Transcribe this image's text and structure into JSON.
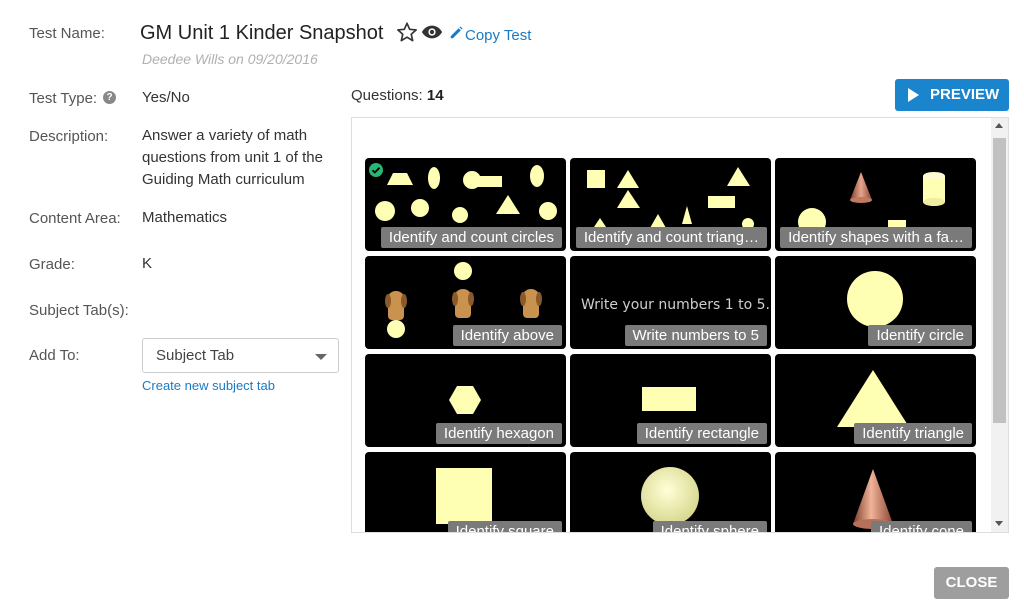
{
  "labels": {
    "test_name": "Test Name:",
    "test_type": "Test Type:",
    "description": "Description:",
    "content_area": "Content Area:",
    "grade": "Grade:",
    "subject_tabs": "Subject Tab(s):",
    "add_to": "Add To:"
  },
  "test": {
    "title": "GM Unit 1 Kinder Snapshot",
    "author_line": "Deedee Wills on 09/20/2016",
    "copy_label": "Copy Test",
    "type": "Yes/No",
    "description_lines": [
      "Answer a variety of math",
      "questions from unit 1 of the",
      "Guiding Math curriculum"
    ],
    "content_area": "Mathematics",
    "grade": "K"
  },
  "add_to": {
    "selected": "Subject Tab",
    "create_link": "Create new subject tab"
  },
  "questions": {
    "label": "Questions:",
    "count": "14"
  },
  "buttons": {
    "preview": "PREVIEW",
    "close": "CLOSE"
  },
  "tiles": [
    {
      "caption": "Identify and count circles"
    },
    {
      "caption": "Identify and count triang…"
    },
    {
      "caption": "Identify shapes with a fa…"
    },
    {
      "caption": "Identify above"
    },
    {
      "caption": "Write numbers to 5",
      "image_text": "Write your numbers 1 to 5."
    },
    {
      "caption": "Identify circle"
    },
    {
      "caption": "Identify hexagon"
    },
    {
      "caption": "Identify rectangle"
    },
    {
      "caption": "Identify triangle"
    },
    {
      "caption": "Identify square"
    },
    {
      "caption": "Identify sphere"
    },
    {
      "caption": "Identify cone"
    }
  ],
  "icons": {
    "favorite": "star-outline-icon",
    "view": "eye-icon",
    "edit": "pencil-icon",
    "help": "question-circle-icon",
    "selected": "check-circle-icon"
  },
  "colors": {
    "accent": "#1a85cc",
    "link": "#1a7bc4",
    "check": "#2bb673",
    "shape_fill": "#ffffb3",
    "close_button": "#9e9e9e"
  }
}
